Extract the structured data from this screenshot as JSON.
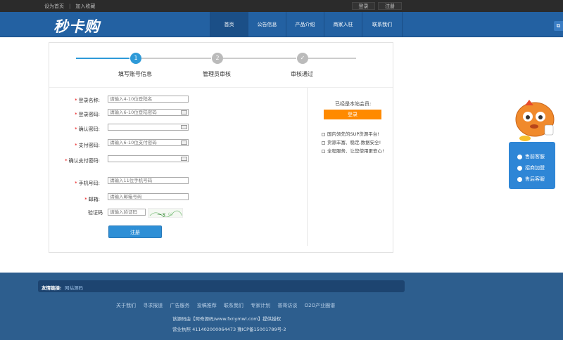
{
  "topbar": {
    "set_home": "设为首页",
    "add_fav": "加入收藏",
    "login": "登录",
    "register": "注册"
  },
  "header": {
    "logo": "秒卡购",
    "nav": [
      "首页",
      "公告信息",
      "产品介绍",
      "商家入驻",
      "联系我们"
    ]
  },
  "steps": [
    {
      "num": "1",
      "label": "填写账号信息"
    },
    {
      "num": "2",
      "label": "管理员审核"
    },
    {
      "num": "✓",
      "label": "审核通过"
    }
  ],
  "form": {
    "username": {
      "label": "登录名称:",
      "placeholder": "请输入4-10位登陆名"
    },
    "password": {
      "label": "登录密码:",
      "placeholder": "请输入6-10位登陆密码"
    },
    "confirm": {
      "label": "确认密码:",
      "placeholder": ""
    },
    "paypwd": {
      "label": "支付密码:",
      "placeholder": "请输入6-10位支付密码"
    },
    "confirm_pay": {
      "label": "确认支付密码:",
      "placeholder": ""
    },
    "phone": {
      "label": "手机号码:",
      "placeholder": "请输入11位手机号码"
    },
    "email": {
      "label": "邮箱:",
      "placeholder": "请输入邮箱号码"
    },
    "captcha": {
      "label": "验证码",
      "placeholder": "请输入验证码"
    },
    "submit": "注册"
  },
  "sidebar": {
    "title": "已经是本站会员:",
    "login_btn": "登录",
    "points": [
      "国内领先的SUP货源平台!",
      "货源丰富、稳定,数据安全!",
      "全程服务、让您使用更安心!"
    ]
  },
  "service": [
    "售前客服",
    "招商加盟",
    "售后客服"
  ],
  "footer": {
    "friend_label": "友情链接:",
    "friend_link": "网站源码",
    "links": [
      "关于我们",
      "寻求报道",
      "广告服务",
      "投稿推荐",
      "联系我们",
      "专家计划",
      "普哥访谈",
      "O2O产业圈谱"
    ],
    "line1": "该源码由【阿奇源码/www.fxnymwl.com】提供授权",
    "line2": "营业执照 411402000064473 豫ICP备15001789号-2"
  },
  "colors": {
    "header_blue": "#2361a2",
    "step_active": "#2e9ad8",
    "step_inactive": "#bbbbbb",
    "orange": "#ff8a00",
    "footer_blue": "#2d5e8e"
  }
}
